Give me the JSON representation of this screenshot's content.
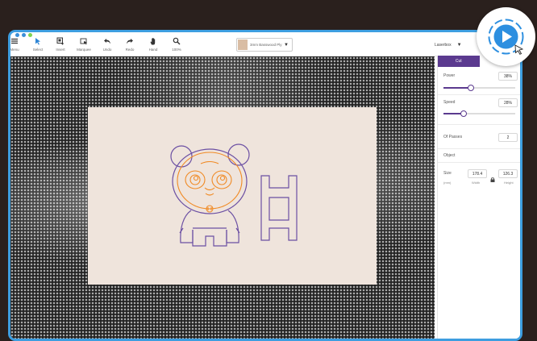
{
  "toolbar": {
    "tools": [
      {
        "label": "Menu",
        "icon": "menu-icon"
      },
      {
        "label": "Select",
        "icon": "select-cursor-icon"
      },
      {
        "label": "Insert",
        "icon": "insert-icon"
      },
      {
        "label": "Marquee",
        "icon": "marquee-icon"
      },
      {
        "label": "Undo",
        "icon": "undo-icon"
      },
      {
        "label": "Redo",
        "icon": "redo-icon"
      },
      {
        "label": "Hand",
        "icon": "hand-icon"
      },
      {
        "label": "100%",
        "icon": "zoom-icon"
      }
    ],
    "material_label": "3mm Basswood Ply",
    "device_label": "Laserbox"
  },
  "panel": {
    "tab_active": "Cut",
    "tab_other": "",
    "power": {
      "label": "Power",
      "value": "38%",
      "level": 0.38
    },
    "speed": {
      "label": "Speed",
      "value": "28%",
      "level": 0.28
    },
    "passes": {
      "label": "Of Passes",
      "value": "2"
    },
    "object_label": "Object",
    "size": {
      "label": "Size",
      "width_value": "178.4",
      "height_value": "126.3",
      "unit": "(mm)",
      "width_label": "Width",
      "height_label": "Height"
    }
  },
  "colors": {
    "accent": "#5b3a8f",
    "frame": "#3d9ee0",
    "cut_line": "#6b4fa3",
    "engrave_line": "#f08a24",
    "workpiece": "#efe4dc",
    "background": "#2a201d"
  }
}
